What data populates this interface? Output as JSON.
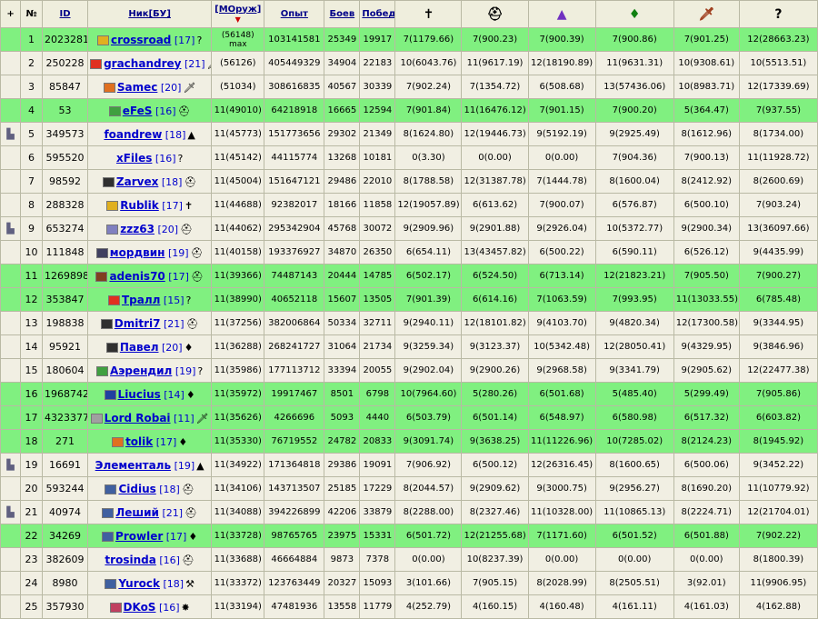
{
  "headers": {
    "plus": "+",
    "num": "№",
    "id": "ID",
    "nick": "Ник[БУ]",
    "mweapon": "[МОруж]",
    "exp": "Опыт",
    "fights": "Боев",
    "wins": "Побед",
    "icons": [
      "cross-icon",
      "helmet-icon",
      "wizard-hat-icon",
      "leaf-icon",
      "dagger-icon",
      "question-icon"
    ]
  },
  "colors": {
    "highlight": "#80f080",
    "normal": "#f1efe3",
    "link": "#0000cc"
  },
  "rows": [
    {
      "n": "1",
      "id": "2023281",
      "nick": "crossroad",
      "lvl": "[17]",
      "icon": "?",
      "mw": "(56148)",
      "mwsub": "max",
      "exp": "103141581",
      "f": "25349",
      "w": "19917",
      "s": [
        "7(1179.66)",
        "7(900.23)",
        "7(900.39)",
        "7(900.86)",
        "7(901.25)",
        "12(28663.23)"
      ],
      "hl": true,
      "badge": "#e0b020",
      "plus": false
    },
    {
      "n": "2",
      "id": "250228",
      "nick": "grachandrey",
      "lvl": "[21]",
      "icon": "🗡",
      "mw": "(56126)",
      "mwsub": "",
      "exp": "405449329",
      "f": "34904",
      "w": "22183",
      "s": [
        "10(6043.76)",
        "11(9617.19)",
        "12(18190.89)",
        "11(9631.31)",
        "10(9308.61)",
        "10(5513.51)"
      ],
      "hl": false,
      "badge": "#e03020",
      "plus": false
    },
    {
      "n": "3",
      "id": "85847",
      "nick": "Samec",
      "lvl": "[20]",
      "icon": "🗡",
      "mw": "(51034)",
      "mwsub": "",
      "exp": "308616835",
      "f": "40567",
      "w": "30339",
      "s": [
        "7(902.24)",
        "7(1354.72)",
        "6(508.68)",
        "13(57436.06)",
        "10(8983.71)",
        "12(17339.69)"
      ],
      "hl": false,
      "badge": "#e07020",
      "plus": false
    },
    {
      "n": "4",
      "id": "53",
      "nick": "eFeS",
      "lvl": "[16]",
      "icon": "⛑",
      "mw": "11(49010)",
      "mwsub": "",
      "exp": "64218918",
      "f": "16665",
      "w": "12594",
      "s": [
        "7(901.84)",
        "11(16476.12)",
        "7(901.15)",
        "7(900.20)",
        "5(364.47)",
        "7(937.55)"
      ],
      "hl": true,
      "badge": "#40a040",
      "plus": false
    },
    {
      "n": "5",
      "id": "349573",
      "nick": "foandrew",
      "lvl": "[18]",
      "icon": "▲",
      "mw": "11(45773)",
      "mwsub": "",
      "exp": "151773656",
      "f": "29302",
      "w": "21349",
      "s": [
        "8(1624.80)",
        "12(19446.73)",
        "9(5192.19)",
        "9(2925.49)",
        "8(1612.96)",
        "8(1734.00)"
      ],
      "hl": false,
      "badge": "",
      "plus": true
    },
    {
      "n": "6",
      "id": "595520",
      "nick": "xFiles",
      "lvl": "[16]",
      "icon": "?",
      "mw": "11(45142)",
      "mwsub": "",
      "exp": "44115774",
      "f": "13268",
      "w": "10181",
      "s": [
        "0(3.30)",
        "0(0.00)",
        "0(0.00)",
        "7(904.36)",
        "7(900.13)",
        "11(11928.72)"
      ],
      "hl": false,
      "badge": "",
      "plus": false
    },
    {
      "n": "7",
      "id": "98592",
      "nick": "Zarvex",
      "lvl": "[18]",
      "icon": "⛑",
      "mw": "11(45004)",
      "mwsub": "",
      "exp": "151647121",
      "f": "29486",
      "w": "22010",
      "s": [
        "8(1788.58)",
        "12(31387.78)",
        "7(1444.78)",
        "8(1600.04)",
        "8(2412.92)",
        "8(2600.69)"
      ],
      "hl": false,
      "badge": "#303030",
      "plus": false
    },
    {
      "n": "8",
      "id": "288328",
      "nick": "Rublik",
      "lvl": "[17]",
      "icon": "✝",
      "mw": "11(44688)",
      "mwsub": "",
      "exp": "92382017",
      "f": "18166",
      "w": "11858",
      "s": [
        "12(19057.89)",
        "6(613.62)",
        "7(900.07)",
        "6(576.87)",
        "6(500.10)",
        "7(903.24)"
      ],
      "hl": false,
      "badge": "#e0b020",
      "plus": false
    },
    {
      "n": "9",
      "id": "653274",
      "nick": "zzz63",
      "lvl": "[20]",
      "icon": "⛑",
      "mw": "11(44062)",
      "mwsub": "",
      "exp": "295342904",
      "f": "45768",
      "w": "30072",
      "s": [
        "9(2909.96)",
        "9(2901.88)",
        "9(2926.04)",
        "10(5372.77)",
        "9(2900.34)",
        "13(36097.66)"
      ],
      "hl": false,
      "badge": "#8080c0",
      "plus": true
    },
    {
      "n": "10",
      "id": "111848",
      "nick": "мордвин",
      "lvl": "[19]",
      "icon": "⛑",
      "mw": "11(40158)",
      "mwsub": "",
      "exp": "193376927",
      "f": "34870",
      "w": "26350",
      "s": [
        "6(654.11)",
        "13(43457.82)",
        "6(500.22)",
        "6(590.11)",
        "6(526.12)",
        "9(4435.99)"
      ],
      "hl": false,
      "badge": "#404060",
      "plus": false
    },
    {
      "n": "11",
      "id": "1269898",
      "nick": "adenis70",
      "lvl": "[17]",
      "icon": "⛑",
      "mw": "11(39366)",
      "mwsub": "",
      "exp": "74487143",
      "f": "20444",
      "w": "14785",
      "s": [
        "6(502.17)",
        "6(524.50)",
        "6(713.14)",
        "12(21823.21)",
        "7(905.50)",
        "7(900.27)"
      ],
      "hl": true,
      "badge": "#804020",
      "plus": false
    },
    {
      "n": "12",
      "id": "353847",
      "nick": "Тралл",
      "lvl": "[15]",
      "icon": "?",
      "mw": "11(38990)",
      "mwsub": "",
      "exp": "40652118",
      "f": "15607",
      "w": "13505",
      "s": [
        "7(901.39)",
        "6(614.16)",
        "7(1063.59)",
        "7(993.95)",
        "11(13033.55)",
        "6(785.48)"
      ],
      "hl": true,
      "badge": "#e03020",
      "plus": false
    },
    {
      "n": "13",
      "id": "198838",
      "nick": "Dmitri7",
      "lvl": "[21]",
      "icon": "⛑",
      "mw": "11(37256)",
      "mwsub": "",
      "exp": "382006864",
      "f": "50334",
      "w": "32711",
      "s": [
        "9(2940.11)",
        "12(18101.82)",
        "9(4103.70)",
        "9(4820.34)",
        "12(17300.58)",
        "9(3344.95)"
      ],
      "hl": false,
      "badge": "#303030",
      "plus": false
    },
    {
      "n": "14",
      "id": "95921",
      "nick": "Павел",
      "lvl": "[20]",
      "icon": "♦",
      "mw": "11(36288)",
      "mwsub": "",
      "exp": "268241727",
      "f": "31064",
      "w": "21734",
      "s": [
        "9(3259.34)",
        "9(3123.37)",
        "10(5342.48)",
        "12(28050.41)",
        "9(4329.95)",
        "9(3846.96)"
      ],
      "hl": false,
      "badge": "#303030",
      "plus": false
    },
    {
      "n": "15",
      "id": "180604",
      "nick": "Аэрендил",
      "lvl": "[19]",
      "icon": "?",
      "mw": "11(35986)",
      "mwsub": "",
      "exp": "177113712",
      "f": "33394",
      "w": "20055",
      "s": [
        "9(2902.04)",
        "9(2900.26)",
        "9(2968.58)",
        "9(3341.79)",
        "9(2905.62)",
        "12(22477.38)"
      ],
      "hl": false,
      "badge": "#40a040",
      "plus": false
    },
    {
      "n": "16",
      "id": "1968742",
      "nick": "Liucius",
      "lvl": "[14]",
      "icon": "♦",
      "mw": "11(35972)",
      "mwsub": "",
      "exp": "19917467",
      "f": "8501",
      "w": "6798",
      "s": [
        "10(7964.60)",
        "5(280.26)",
        "6(501.68)",
        "5(485.40)",
        "5(299.49)",
        "7(905.86)"
      ],
      "hl": true,
      "badge": "#2040a0",
      "plus": false
    },
    {
      "n": "17",
      "id": "4323377",
      "nick": "Lord Robai",
      "lvl": "[11]",
      "icon": "🗡",
      "mw": "11(35626)",
      "mwsub": "",
      "exp": "4266696",
      "f": "5093",
      "w": "4440",
      "s": [
        "6(503.79)",
        "6(501.14)",
        "6(548.97)",
        "6(580.98)",
        "6(517.32)",
        "6(603.82)"
      ],
      "hl": true,
      "badge": "#a0a0a0",
      "plus": false
    },
    {
      "n": "18",
      "id": "271",
      "nick": "tolik",
      "lvl": "[17]",
      "icon": "♦",
      "mw": "11(35330)",
      "mwsub": "",
      "exp": "76719552",
      "f": "24782",
      "w": "20833",
      "s": [
        "9(3091.74)",
        "9(3638.25)",
        "11(11226.96)",
        "10(7285.02)",
        "8(2124.23)",
        "8(1945.92)"
      ],
      "hl": true,
      "badge": "#e07020",
      "plus": false
    },
    {
      "n": "19",
      "id": "16691",
      "nick": "Элементаль",
      "lvl": "[19]",
      "icon": "▲",
      "mw": "11(34922)",
      "mwsub": "",
      "exp": "171364818",
      "f": "29386",
      "w": "19091",
      "s": [
        "7(906.92)",
        "6(500.12)",
        "12(26316.45)",
        "8(1600.65)",
        "6(500.06)",
        "9(3452.22)"
      ],
      "hl": false,
      "badge": "",
      "plus": true
    },
    {
      "n": "20",
      "id": "593244",
      "nick": "Cidius",
      "lvl": "[18]",
      "icon": "⛑",
      "mw": "11(34106)",
      "mwsub": "",
      "exp": "143713507",
      "f": "25185",
      "w": "17229",
      "s": [
        "8(2044.57)",
        "9(2909.62)",
        "9(3000.75)",
        "9(2956.27)",
        "8(1690.20)",
        "11(10779.92)"
      ],
      "hl": false,
      "badge": "#4060a0",
      "plus": false
    },
    {
      "n": "21",
      "id": "40974",
      "nick": "Леший",
      "lvl": "[21]",
      "icon": "⛑",
      "mw": "11(34088)",
      "mwsub": "",
      "exp": "394226899",
      "f": "42206",
      "w": "33879",
      "s": [
        "8(2288.00)",
        "8(2327.46)",
        "11(10328.00)",
        "11(10865.13)",
        "8(2224.71)",
        "12(21704.01)"
      ],
      "hl": false,
      "badge": "#4060a0",
      "plus": true
    },
    {
      "n": "22",
      "id": "34269",
      "nick": "Prowler",
      "lvl": "[17]",
      "icon": "♦",
      "mw": "11(33728)",
      "mwsub": "",
      "exp": "98765765",
      "f": "23975",
      "w": "15331",
      "s": [
        "6(501.72)",
        "12(21255.68)",
        "7(1171.60)",
        "6(501.52)",
        "6(501.88)",
        "7(902.22)"
      ],
      "hl": true,
      "badge": "#4060a0",
      "plus": false
    },
    {
      "n": "23",
      "id": "382609",
      "nick": "trosinda",
      "lvl": "[16]",
      "icon": "⛑",
      "mw": "11(33688)",
      "mwsub": "",
      "exp": "46664884",
      "f": "9873",
      "w": "7378",
      "s": [
        "0(0.00)",
        "10(8237.39)",
        "0(0.00)",
        "0(0.00)",
        "0(0.00)",
        "8(1800.39)"
      ],
      "hl": false,
      "badge": "",
      "plus": false
    },
    {
      "n": "24",
      "id": "8980",
      "nick": "Yurock",
      "lvl": "[18]",
      "icon": "⚒",
      "mw": "11(33372)",
      "mwsub": "",
      "exp": "123763449",
      "f": "20327",
      "w": "15093",
      "s": [
        "3(101.66)",
        "7(905.15)",
        "8(2028.99)",
        "8(2505.51)",
        "3(92.01)",
        "11(9906.95)"
      ],
      "hl": false,
      "badge": "#4060a0",
      "plus": false
    },
    {
      "n": "25",
      "id": "357930",
      "nick": "DKoS",
      "lvl": "[16]",
      "icon": "✸",
      "mw": "11(33194)",
      "mwsub": "",
      "exp": "47481936",
      "f": "13558",
      "w": "11779",
      "s": [
        "4(252.79)",
        "4(160.15)",
        "4(160.48)",
        "4(161.11)",
        "4(161.03)",
        "4(162.88)"
      ],
      "hl": false,
      "badge": "#c04060",
      "plus": false
    }
  ]
}
